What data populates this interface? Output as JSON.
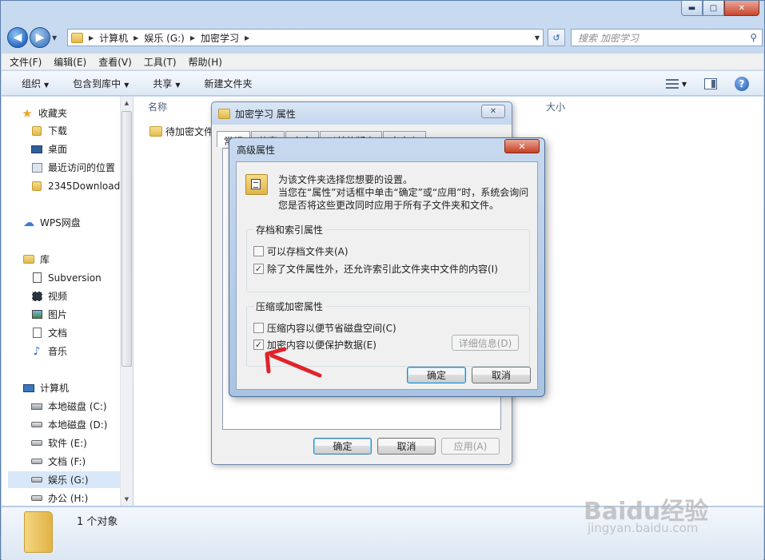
{
  "window": {
    "buttons": {
      "minimize": "▬",
      "maximize": "□",
      "close": "✕"
    }
  },
  "address": {
    "segments": [
      "计算机",
      "娱乐 (G:)",
      "加密学习"
    ],
    "search_placeholder": "搜索 加密学习"
  },
  "menu": [
    "文件(F)",
    "编辑(E)",
    "查看(V)",
    "工具(T)",
    "帮助(H)"
  ],
  "toolbar": {
    "organize": "组织",
    "include_library": "包含到库中",
    "share": "共享",
    "new_folder": "新建文件夹"
  },
  "nav": {
    "favorites": "收藏夹",
    "downloads": "下载",
    "desktop": "桌面",
    "recent": "最近访问的位置",
    "downloads2345": "2345Downloads",
    "wps": "WPS网盘",
    "libraries": "库",
    "subversion": "Subversion",
    "videos": "视频",
    "pictures": "图片",
    "documents": "文档",
    "music": "音乐",
    "computer": "计算机",
    "drive_c": "本地磁盘 (C:)",
    "drive_d": "本地磁盘 (D:)",
    "drive_e": "软件 (E:)",
    "drive_f": "文档 (F:)",
    "drive_g": "娱乐 (G:)",
    "drive_h": "办公 (H:)"
  },
  "content": {
    "col_name": "名称",
    "col_size": "大小",
    "file_name": "待加密文件"
  },
  "status": {
    "count": "1 个对象"
  },
  "props_dialog": {
    "title": "加密学习 属性",
    "tabs": [
      "常规",
      "共享",
      "安全",
      "以前的版本",
      "自定义"
    ],
    "ok": "确定",
    "cancel": "取消",
    "apply": "应用(A)"
  },
  "adv_dialog": {
    "title": "高级属性",
    "close": "✕",
    "desc1": "为该文件夹选择您想要的设置。",
    "desc2": "当您在“属性”对话框中单击“确定”或“应用”时，系统会询问您是否将这些更改同时应用于所有子文件夹和文件。",
    "group1_title": "存档和索引属性",
    "archive": "可以存档文件夹(A)",
    "archive_checked": false,
    "index": "除了文件属性外，还允许索引此文件夹中文件的内容(I)",
    "index_checked": true,
    "group2_title": "压缩或加密属性",
    "compress": "压缩内容以便节省磁盘空间(C)",
    "compress_checked": false,
    "encrypt": "加密内容以便保护数据(E)",
    "encrypt_checked": true,
    "details": "详细信息(D)",
    "ok": "确定",
    "cancel": "取消"
  },
  "watermark": {
    "brand": "Baidu经验",
    "url": "jingyan.baidu.com"
  },
  "colors": {
    "arrow": "#e0242a",
    "accent": "#3c7fb1"
  }
}
